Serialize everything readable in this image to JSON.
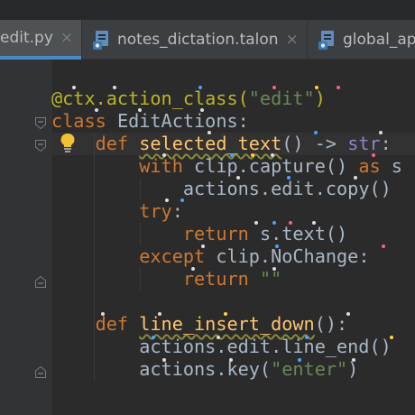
{
  "tabs": [
    {
      "label": "edit.py",
      "close": "×",
      "icon": "python-file-icon",
      "active": true
    },
    {
      "label": "notes_dictation.talon",
      "close": "×",
      "icon": "talon-file-icon",
      "active": false
    },
    {
      "label": "global_ap",
      "close": "",
      "icon": "talon-file-icon",
      "active": false
    }
  ],
  "editor": {
    "lines": [
      {
        "segments": [
          {
            "text": "@ctx.action_class(",
            "cls": "deco"
          },
          {
            "text": "\"edit\"",
            "cls": "str"
          },
          {
            "text": ")",
            "cls": "deco"
          }
        ]
      },
      {
        "segments": [
          {
            "text": "class ",
            "cls": "kw"
          },
          {
            "text": "EditActions:",
            "cls": "plain"
          }
        ]
      },
      {
        "segments": [
          {
            "text": "    "
          },
          {
            "text": "def ",
            "cls": "kw"
          },
          {
            "text": "selected_text",
            "cls": "fn wavy"
          },
          {
            "text": "() -> ",
            "cls": "plain"
          },
          {
            "text": "str",
            "cls": "tp"
          },
          {
            "text": ":",
            "cls": "plain"
          }
        ]
      },
      {
        "segments": [
          {
            "text": "        "
          },
          {
            "text": "with ",
            "cls": "kw"
          },
          {
            "text": "clip.capture() ",
            "cls": "plain"
          },
          {
            "text": "as ",
            "cls": "kw"
          },
          {
            "text": "s",
            "cls": "plain"
          }
        ]
      },
      {
        "segments": [
          {
            "text": "            "
          },
          {
            "text": "actions.edit.copy()",
            "cls": "plain"
          }
        ]
      },
      {
        "segments": [
          {
            "text": "        "
          },
          {
            "text": "try",
            "cls": "kw"
          },
          {
            "text": ":",
            "cls": "plain"
          }
        ]
      },
      {
        "segments": [
          {
            "text": "            "
          },
          {
            "text": "return ",
            "cls": "kw"
          },
          {
            "text": "s.text()",
            "cls": "plain"
          }
        ]
      },
      {
        "segments": [
          {
            "text": "        "
          },
          {
            "text": "except ",
            "cls": "kw"
          },
          {
            "text": "clip.NoChange:",
            "cls": "plain"
          }
        ]
      },
      {
        "segments": [
          {
            "text": "            "
          },
          {
            "text": "return ",
            "cls": "kw"
          },
          {
            "text": "\"\"",
            "cls": "str"
          }
        ]
      },
      {
        "segments": [
          {
            "text": ""
          }
        ]
      },
      {
        "segments": [
          {
            "text": "    "
          },
          {
            "text": "def ",
            "cls": "kw"
          },
          {
            "text": "line_insert_down",
            "cls": "fn wavy"
          },
          {
            "text": "():",
            "cls": "plain"
          }
        ]
      },
      {
        "segments": [
          {
            "text": "        "
          },
          {
            "text": "actions.edit.line_end()",
            "cls": "plain"
          }
        ]
      },
      {
        "segments": [
          {
            "text": "        "
          },
          {
            "text": "actions.key(",
            "cls": "plain"
          },
          {
            "text": "\"enter\"",
            "cls": "str"
          },
          {
            "text": ")",
            "cls": "plain"
          }
        ]
      }
    ]
  },
  "gutter_icons": [
    "fold-icon",
    "fold-icon",
    "intention-bulb-icon",
    "fold-end-icon",
    "fold-end-icon"
  ],
  "colors": {
    "keyword": "#cc7832",
    "decorator": "#bbb529",
    "string": "#6a8759",
    "function": "#ffc66d",
    "builtin_type": "#8888c6",
    "text": "#a9b7c6",
    "active_tab_underline": "#4a88c7"
  }
}
